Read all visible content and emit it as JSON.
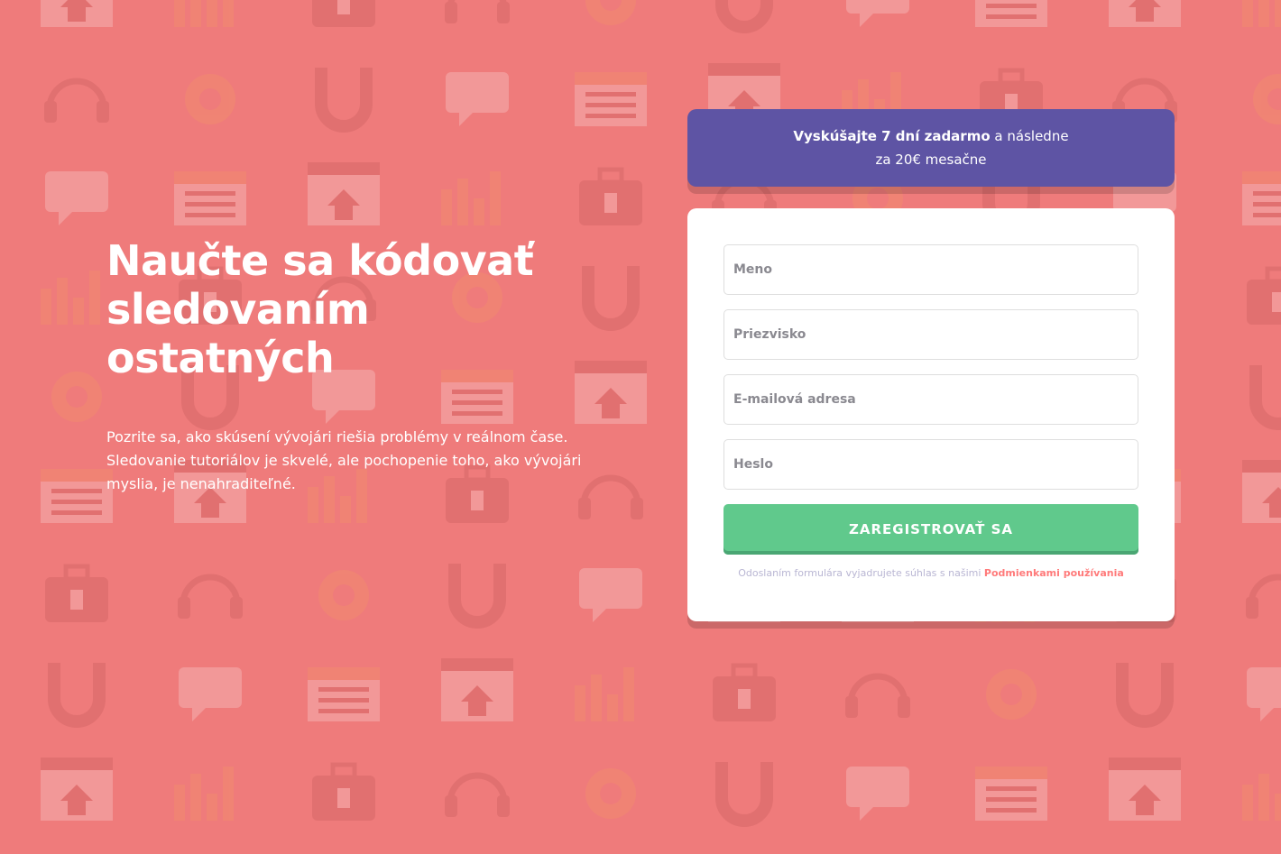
{
  "hero": {
    "title": "Naučte sa kódovať sledovaním ostatných",
    "description": "Pozrite sa, ako skúsení vývojári riešia problémy v reálnom čase. Sledovanie tutoriálov je skvelé, ale pochopenie toho, ako vývojári myslia, je nenahraditeľné."
  },
  "promo": {
    "bold": "Vyskúšajte 7 dní zadarmo",
    "rest": "a následne",
    "line2": "za 20€ mesačne"
  },
  "form": {
    "first_name_placeholder": "Meno",
    "last_name_placeholder": "Priezvisko",
    "email_placeholder": "E-mailová adresa",
    "password_placeholder": "Heslo",
    "submit_label": "ZAREGISTROVAŤ SA",
    "terms_text": "Odoslaním formulára vyjadrujete súhlas s našimi",
    "terms_link": "Podmienkami používania"
  },
  "colors": {
    "background": "#ef7b7b",
    "promo": "#5e54a4",
    "submit": "#60c98c",
    "link": "#ff7a7a"
  }
}
